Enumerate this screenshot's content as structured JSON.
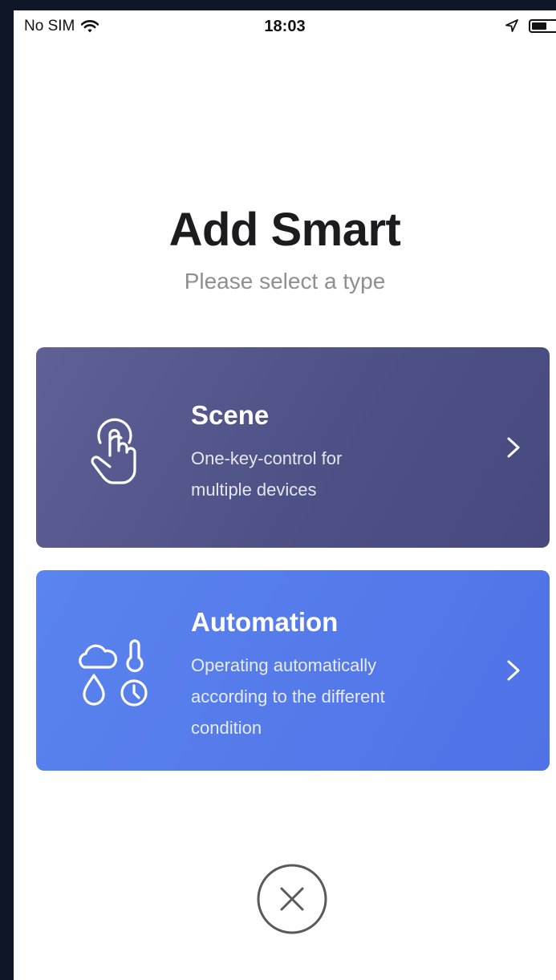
{
  "status_bar": {
    "carrier": "No SIM",
    "time": "18:03",
    "battery_level": 0.5
  },
  "header": {
    "title": "Add Smart",
    "subtitle": "Please select a type"
  },
  "cards": [
    {
      "title": "Scene",
      "description": "One-key-control for multiple devices",
      "icon": "tap-hand-icon",
      "color": "#4e5186"
    },
    {
      "title": "Automation",
      "description": "Operating automatically according to the different condition",
      "icon": "conditions-icon",
      "color": "#5479ea"
    }
  ],
  "close": {
    "icon": "close-icon"
  }
}
